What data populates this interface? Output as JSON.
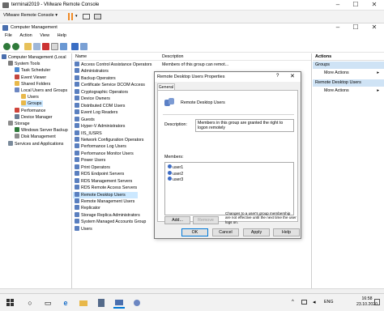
{
  "vm": {
    "title": "terminal2019 - VMware Remote Console",
    "menu_label": "VMware Remote Console",
    "colors": {
      "pause": "#f08a24",
      "accent": "#0078d7"
    }
  },
  "cm": {
    "title": "Computer Management",
    "menu": [
      "File",
      "Action",
      "View",
      "Help"
    ]
  },
  "tree": [
    {
      "label": "Computer Management (Local",
      "indent": 0,
      "icon": "computer-icon"
    },
    {
      "label": "System Tools",
      "indent": 1,
      "icon": "tools-icon"
    },
    {
      "label": "Task Scheduler",
      "indent": 2,
      "icon": "clock-icon"
    },
    {
      "label": "Event Viewer",
      "indent": 2,
      "icon": "event-icon"
    },
    {
      "label": "Shared Folders",
      "indent": 2,
      "icon": "folder-icon"
    },
    {
      "label": "Local Users and Groups",
      "indent": 2,
      "icon": "users-icon"
    },
    {
      "label": "Users",
      "indent": 3,
      "icon": "folder-icon"
    },
    {
      "label": "Groups",
      "indent": 3,
      "icon": "folder-icon",
      "selected": true
    },
    {
      "label": "Performance",
      "indent": 2,
      "icon": "perf-icon"
    },
    {
      "label": "Device Manager",
      "indent": 2,
      "icon": "device-icon"
    },
    {
      "label": "Storage",
      "indent": 1,
      "icon": "storage-icon"
    },
    {
      "label": "Windows Server Backup",
      "indent": 2,
      "icon": "backup-icon"
    },
    {
      "label": "Disk Management",
      "indent": 2,
      "icon": "disk-icon"
    },
    {
      "label": "Services and Applications",
      "indent": 1,
      "icon": "services-icon"
    }
  ],
  "list": {
    "headers": {
      "name": "Name",
      "description": "Description"
    },
    "first_description": "Members of this group can remot...",
    "rows": [
      "Access Control Assistance Operators",
      "Administrators",
      "Backup Operators",
      "Certificate Service DCOM Access",
      "Cryptographic Operators",
      "Device Owners",
      "Distributed COM Users",
      "Event Log Readers",
      "Guests",
      "Hyper-V Administrators",
      "IIS_IUSRS",
      "Network Configuration Operators",
      "Performance Log Users",
      "Performance Monitor Users",
      "Power Users",
      "Print Operators",
      "RDS Endpoint Servers",
      "RDS Management Servers",
      "RDS Remote Access Servers",
      "Remote Desktop Users",
      "Remote Management Users",
      "Replicator",
      "Storage Replica Administrators",
      "System Managed Accounts Group",
      "Users"
    ],
    "selected": "Remote Desktop Users"
  },
  "actions": {
    "header": "Actions",
    "sections": [
      {
        "title": "Groups",
        "item": "More Actions"
      },
      {
        "title": "Remote Desktop Users",
        "item": "More Actions"
      }
    ]
  },
  "dialog": {
    "title": "Remote Desktop Users Properties",
    "help": "?",
    "tab": "General",
    "group_name": "Remote Desktop Users",
    "description_label": "Description:",
    "description": "Members in this group are granted the right to logon remotely",
    "members_label": "Members:",
    "members": [
      "user1",
      "user2",
      "user3"
    ],
    "add": "Add...",
    "remove": "Remove",
    "note": "Changes to a user's group membership are not effective until the next time the user logs on.",
    "ok": "OK",
    "cancel": "Cancel",
    "apply": "Apply",
    "help_btn": "Help"
  },
  "taskbar": {
    "lang": "ENG",
    "time": "16:58",
    "date": "23.10.2020"
  }
}
